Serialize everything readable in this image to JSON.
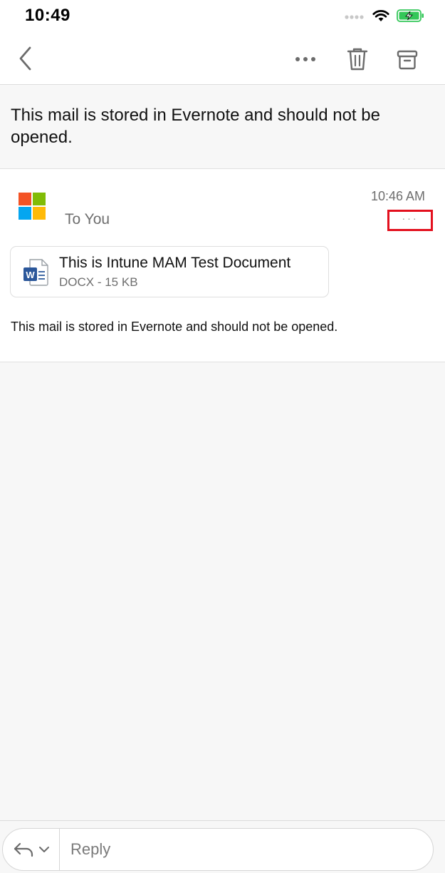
{
  "status_bar": {
    "time": "10:49",
    "icons": [
      "signal-icon",
      "wifi-icon",
      "battery-charging-icon"
    ],
    "battery_color": "#34c759"
  },
  "navbar": {
    "icons": [
      "back-chevron-icon",
      "more-horizontal-icon",
      "trash-icon",
      "archive-icon"
    ]
  },
  "subject": "This mail is stored in Evernote and should not be opened.",
  "message": {
    "sender_logo": "microsoft-logo",
    "recipient": "To You",
    "time": "10:46 AM",
    "more_label": "···",
    "highlight_color": "#e3101e",
    "attachment": {
      "icon": "word-doc-icon",
      "name": "This is Intune MAM Test Document",
      "meta": "DOCX - 15 KB"
    },
    "body": "This mail is stored in Evernote and should not be opened."
  },
  "reply_bar": {
    "icons": [
      "reply-icon",
      "chevron-down-icon"
    ],
    "placeholder": "Reply"
  }
}
